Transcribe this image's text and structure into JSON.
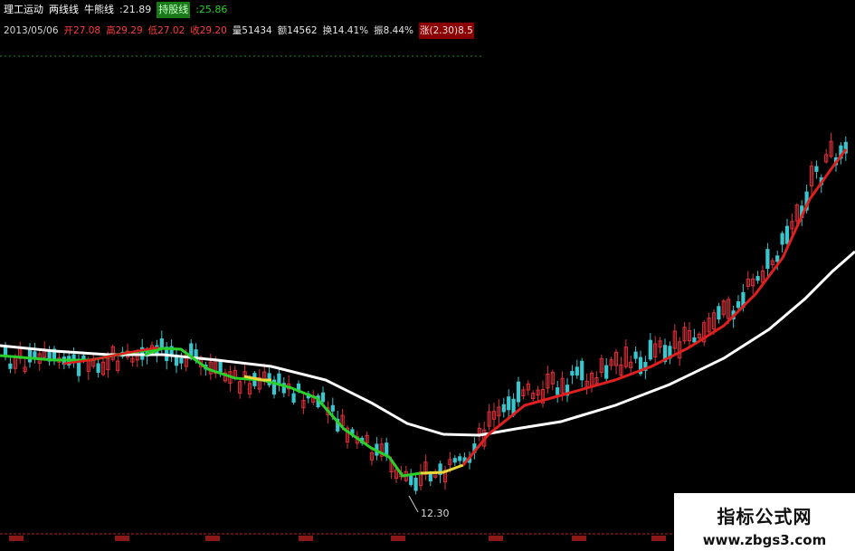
{
  "header": {
    "row1": [
      {
        "text": "理工运动",
        "kind": "name"
      },
      {
        "text": "两线线",
        "kind": "name"
      },
      {
        "text": "牛熊线",
        "kind": "name"
      },
      {
        "text": ":21.89",
        "kind": "white"
      },
      {
        "text": "持股线",
        "kind": "label"
      },
      {
        "text": ":25.86",
        "kind": "green"
      }
    ],
    "row2": [
      {
        "text": "2013/05/06",
        "kind": "date"
      },
      {
        "text": "开27.08",
        "kind": "red"
      },
      {
        "text": "高29.29",
        "kind": "red"
      },
      {
        "text": "低27.02",
        "kind": "red"
      },
      {
        "text": "收29.20",
        "kind": "red"
      },
      {
        "text": "量51434",
        "kind": "white"
      },
      {
        "text": "额14562",
        "kind": "white"
      },
      {
        "text": "换14.41%",
        "kind": "white"
      },
      {
        "text": "振8.44%",
        "kind": "white"
      },
      {
        "text": "涨(2.30)8.5",
        "kind": "redbg"
      }
    ]
  },
  "chart": {
    "low_label": "12.30",
    "colors": {
      "background": "#000000",
      "candle_up": "#e0303a",
      "candle_down": "#39c6cf",
      "bull_bear_line": "#ffffff",
      "hold_line_up": "#e0201e",
      "hold_line_down": "#2ad12a",
      "hold_line_neutral": "#e8d83a",
      "separator": "#1f8f1f",
      "axis": "#bb2020"
    }
  },
  "watermark": {
    "title": "指标公式网",
    "url": "www.zbgs3.com"
  }
}
